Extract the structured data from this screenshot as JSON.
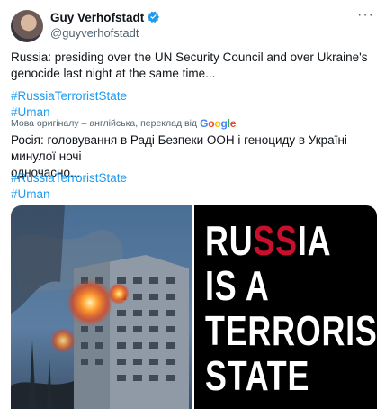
{
  "author": {
    "name": "Guy Verhofstadt",
    "handle": "@guyverhofstadt"
  },
  "menu": {
    "label": "···"
  },
  "tweet": {
    "text_line1": "Russia: presiding over the UN Security Council and over Ukraine's",
    "text_line2": "genocide last night at the same time...",
    "hashtag1": "#RussiaTerroristState",
    "hashtag2": "#Uman"
  },
  "translation": {
    "notice": "Мова оригіналу – англійська, переклад від",
    "provider": "Google",
    "text_line1": "Росія: головування в Раді Безпеки ООН і геноциду в Україні минулої ночі",
    "text_line2": "одночасно...",
    "hashtag1": "#RussiaTerroristState",
    "hashtag2": "#Uman"
  },
  "poster": {
    "line1_pre": "RU",
    "line1_highlight": "SS",
    "line1_post": "IA",
    "line2": "IS A",
    "line3": "TERRORIST",
    "line4": "STATE"
  },
  "colors": {
    "link": "#1d9bf0",
    "verified": "#1d9bf0",
    "accent_red": "#c8102e"
  }
}
